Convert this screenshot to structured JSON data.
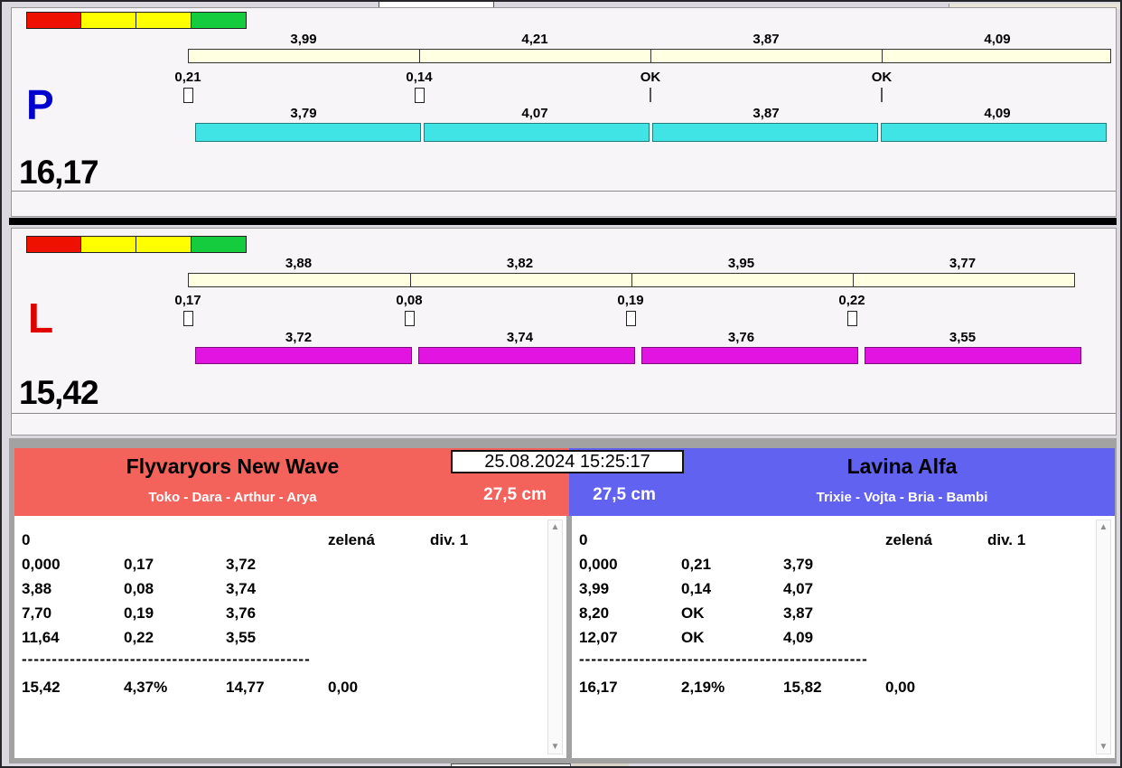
{
  "meta": {
    "timestamp": "25.08.2024 15:25:17"
  },
  "colors": {
    "traffic": [
      "#ee1100",
      "#ffff00",
      "#ffff00",
      "#15cc3f"
    ],
    "cream_bar": "#ffffe2",
    "cyan_bar": "#41e4e4",
    "magenta_bar": "#e214e2",
    "letter_p": "#0000d0",
    "letter_l": "#e00000",
    "team_left_header": "#f4625c",
    "team_right_header": "#6262f0"
  },
  "lanes": [
    {
      "letter": "P",
      "total": "16,17",
      "top_splits": [
        "3,99",
        "4,21",
        "3,87",
        "4,09"
      ],
      "gate_marks": [
        "0,21",
        "0,14",
        "OK",
        "OK"
      ],
      "bottom_splits": [
        "3,79",
        "4,07",
        "3,87",
        "4,09"
      ]
    },
    {
      "letter": "L",
      "total": "15,42",
      "top_splits": [
        "3,88",
        "3,82",
        "3,95",
        "3,77"
      ],
      "gate_marks": [
        "0,17",
        "0,08",
        "0,19",
        "0,22"
      ],
      "bottom_splits": [
        "3,72",
        "3,74",
        "3,76",
        "3,55"
      ]
    }
  ],
  "teams": [
    {
      "name": "Flyvaryors New Wave",
      "dogs": "Toko - Dara - Arthur - Arya",
      "height": "27,5 cm",
      "table": {
        "row0": [
          "0",
          "zelená",
          "div. 1"
        ],
        "rows": [
          [
            "0,000",
            "0,17",
            "3,72"
          ],
          [
            "3,88",
            "0,08",
            "3,74"
          ],
          [
            "7,70",
            "0,19",
            "3,76"
          ],
          [
            "11,64",
            "0,22",
            "3,55"
          ]
        ],
        "divider": "------------------------------------------------",
        "totals": [
          "15,42",
          "4,37%",
          "14,77",
          "0,00"
        ]
      }
    },
    {
      "name": "Lavina Alfa",
      "dogs": "Trixie - Vojta - Bria - Bambi",
      "height": "27,5 cm",
      "table": {
        "row0": [
          "0",
          "zelená",
          "div. 1"
        ],
        "rows": [
          [
            "0,000",
            "0,21",
            "3,79"
          ],
          [
            "3,99",
            "0,14",
            "4,07"
          ],
          [
            "8,20",
            "OK",
            "3,87"
          ],
          [
            "12,07",
            "OK",
            "4,09"
          ]
        ],
        "divider": "------------------------------------------------",
        "totals": [
          "16,17",
          "2,19%",
          "15,82",
          "0,00"
        ]
      }
    }
  ],
  "scrollbar": {
    "up_arrow": "▲",
    "down_arrow": "▼"
  }
}
